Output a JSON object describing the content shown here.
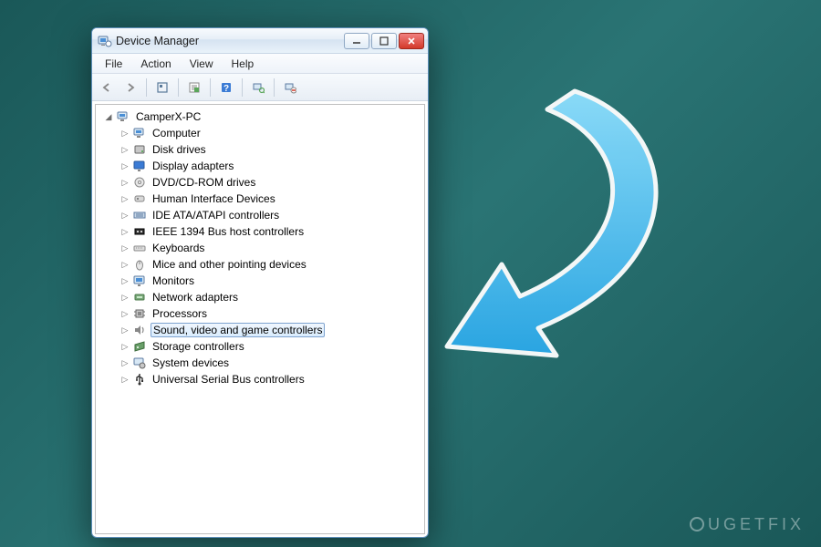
{
  "window": {
    "title": "Device Manager"
  },
  "menu": {
    "file": "File",
    "action": "Action",
    "view": "View",
    "help": "Help"
  },
  "toolbar_icons": {
    "back": "back-arrow-icon",
    "forward": "forward-arrow-icon",
    "show_hidden": "show-hidden-icon",
    "properties": "properties-icon",
    "help": "help-icon",
    "scan": "scan-icon",
    "uninstall": "uninstall-icon"
  },
  "tree": {
    "root": "CamperX-PC",
    "items": [
      {
        "label": "Computer",
        "icon": "computer"
      },
      {
        "label": "Disk drives",
        "icon": "disk"
      },
      {
        "label": "Display adapters",
        "icon": "display"
      },
      {
        "label": "DVD/CD-ROM drives",
        "icon": "dvd"
      },
      {
        "label": "Human Interface Devices",
        "icon": "hid"
      },
      {
        "label": "IDE ATA/ATAPI controllers",
        "icon": "ide"
      },
      {
        "label": "IEEE 1394 Bus host controllers",
        "icon": "ieee"
      },
      {
        "label": "Keyboards",
        "icon": "keyboard"
      },
      {
        "label": "Mice and other pointing devices",
        "icon": "mouse"
      },
      {
        "label": "Monitors",
        "icon": "monitor"
      },
      {
        "label": "Network adapters",
        "icon": "network"
      },
      {
        "label": "Processors",
        "icon": "cpu"
      },
      {
        "label": "Sound, video and game controllers",
        "icon": "sound",
        "selected": true
      },
      {
        "label": "Storage controllers",
        "icon": "storage"
      },
      {
        "label": "System devices",
        "icon": "system"
      },
      {
        "label": "Universal Serial Bus controllers",
        "icon": "usb"
      }
    ]
  },
  "watermark": "UGETFIX",
  "colors": {
    "arrow": "#3fc1ff",
    "selection_border": "#7da2ce"
  }
}
